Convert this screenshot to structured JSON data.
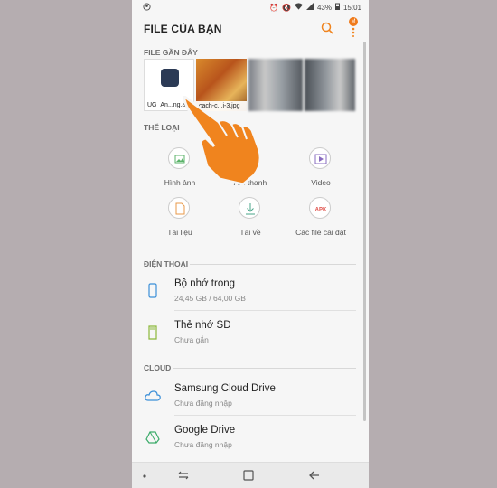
{
  "status_bar": {
    "battery": "43%",
    "time": "15:01"
  },
  "header": {
    "title": "FILE CỦA BẠN",
    "badge": "M"
  },
  "recent": {
    "label": "FILE GẦN ĐÂY",
    "items": [
      {
        "caption": "UG_An...ng.apk",
        "kind": "apk"
      },
      {
        "caption": "cach-c...i-3.jpg",
        "kind": "image"
      },
      {
        "caption": "",
        "kind": "blurred"
      },
      {
        "caption": "",
        "kind": "blurred"
      }
    ]
  },
  "categories": {
    "label": "THỂ LOẠI",
    "items": [
      {
        "label": "Hình ảnh",
        "icon": "image-icon",
        "color": "#5bb36a"
      },
      {
        "label": "Âm thanh",
        "icon": "music-icon",
        "color": "#7c6cc0"
      },
      {
        "label": "Video",
        "icon": "video-icon",
        "color": "#8a6cc0"
      },
      {
        "label": "Tài liệu",
        "icon": "document-icon",
        "color": "#e89a4a"
      },
      {
        "label": "Tải về",
        "icon": "download-icon",
        "color": "#4aa58a"
      },
      {
        "label": "Các file cài đặt",
        "icon": "apk-icon",
        "color": "#e0504a"
      }
    ]
  },
  "phone_storage": {
    "label": "ĐIỆN THOẠI",
    "items": [
      {
        "title": "Bộ nhớ trong",
        "subtitle": "24,45 GB / 64,00 GB",
        "icon": "phone-storage-icon"
      },
      {
        "title": "Thẻ nhớ SD",
        "subtitle": "Chưa gắn",
        "icon": "sd-card-icon"
      }
    ]
  },
  "cloud": {
    "label": "CLOUD",
    "items": [
      {
        "title": "Samsung Cloud Drive",
        "subtitle": "Chưa đăng nhập",
        "icon": "samsung-cloud-icon"
      },
      {
        "title": "Google Drive",
        "subtitle": "Chưa đăng nhập",
        "icon": "google-drive-icon"
      }
    ]
  },
  "colors": {
    "accent": "#f0841e",
    "background": "#f6f6f6"
  }
}
